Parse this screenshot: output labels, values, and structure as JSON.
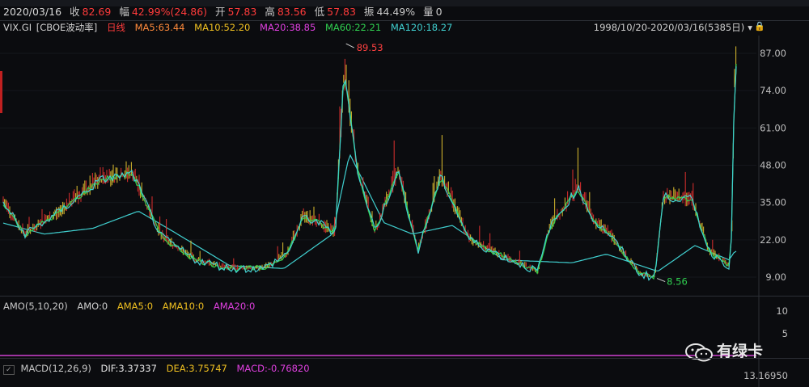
{
  "quote": {
    "date": "2020/03/16",
    "close_label": "收",
    "close_value": "82.69",
    "change_label": "幅",
    "change_value": "42.99%(24.86)",
    "open_label": "开",
    "open_value": "57.83",
    "high_label": "高",
    "high_value": "83.56",
    "low_label": "低",
    "low_value": "57.83",
    "amp_label": "振",
    "amp_value": "44.49%",
    "vol_label": "量",
    "vol_value": "0"
  },
  "indicators": {
    "symbol": "VIX.GI",
    "name": "[CBOE波动率]",
    "period": "日线",
    "ma5": "MA5:63.44",
    "ma10": "MA10:52.20",
    "ma20": "MA20:38.85",
    "ma60": "MA60:22.21",
    "ma120": "MA120:18.27",
    "date_range": "1998/10/20-2020/03/16(5385日)"
  },
  "colors": {
    "ma5": "#e6e6e6",
    "ma10": "#f0c020",
    "ma20": "#e040e0",
    "ma60": "#30d050",
    "ma120": "#40d0d0",
    "up": "#e03030",
    "down": "#30c0c0",
    "macd_line": "#d040d0"
  },
  "amo": {
    "title": "AMO(5,10,20)",
    "amo": "AMO:0",
    "ama5": "AMA5:0",
    "ama10": "AMA10:0",
    "ama20": "AMA20:0"
  },
  "macd": {
    "title": "MACD(12,26,9)",
    "dif": "DIF:3.37337",
    "dea": "DEA:3.75747",
    "macd": "MACD:-0.76820",
    "axis_top": "13.16950"
  },
  "amo_axis": [
    "10",
    "5"
  ],
  "watermark": "有绿卡",
  "chart_data": {
    "type": "line",
    "title": "",
    "y_ticks": [
      "87.00",
      "74.00",
      "61.00",
      "48.00",
      "35.00",
      "22.00",
      "9.00"
    ],
    "ylim": [
      9,
      87
    ],
    "x_start": "1998/10/20",
    "x_end": "2020/03/16",
    "annotations": [
      {
        "label": "89.53",
        "x": "2008/10/24",
        "y": 89.53
      },
      {
        "label": "8.56",
        "x": "2017/11/24",
        "y": 8.56
      }
    ],
    "series": [
      {
        "name": "VIX",
        "x": [
          "1998/10",
          "1999/06",
          "2000/04",
          "2001/09",
          "2002/08",
          "2003/06",
          "2004/06",
          "2005/06",
          "2006/06",
          "2007/02",
          "2007/08",
          "2008/01",
          "2008/07",
          "2008/10",
          "2008/11",
          "2009/03",
          "2009/09",
          "2010/05",
          "2010/12",
          "2011/08",
          "2012/06",
          "2013/06",
          "2014/06",
          "2014/10",
          "2015/08",
          "2016/02",
          "2016/06",
          "2017/06",
          "2017/11",
          "2018/02",
          "2018/12",
          "2019/06",
          "2020/01",
          "2020/02",
          "2020/03"
        ],
        "values": [
          36,
          24,
          30,
          43,
          45,
          23,
          15,
          12,
          12,
          17,
          30,
          28,
          24,
          80,
          75,
          45,
          25,
          46,
          18,
          44,
          22,
          16,
          11,
          26,
          40,
          28,
          25,
          10,
          9,
          37,
          36,
          18,
          13,
          25,
          83
        ]
      },
      {
        "name": "MA120",
        "x": [
          "1998/10",
          "2000/01",
          "2001/06",
          "2002/10",
          "2003/10",
          "2005/06",
          "2007/01",
          "2008/06",
          "2008/12",
          "2009/12",
          "2010/10",
          "2011/12",
          "2013/06",
          "2015/06",
          "2016/06",
          "2017/12",
          "2019/01",
          "2020/01",
          "2020/03"
        ],
        "values": [
          28,
          24,
          26,
          32,
          25,
          13,
          12,
          24,
          52,
          28,
          24,
          27,
          15,
          14,
          17,
          11,
          20,
          15,
          18
        ]
      }
    ]
  }
}
